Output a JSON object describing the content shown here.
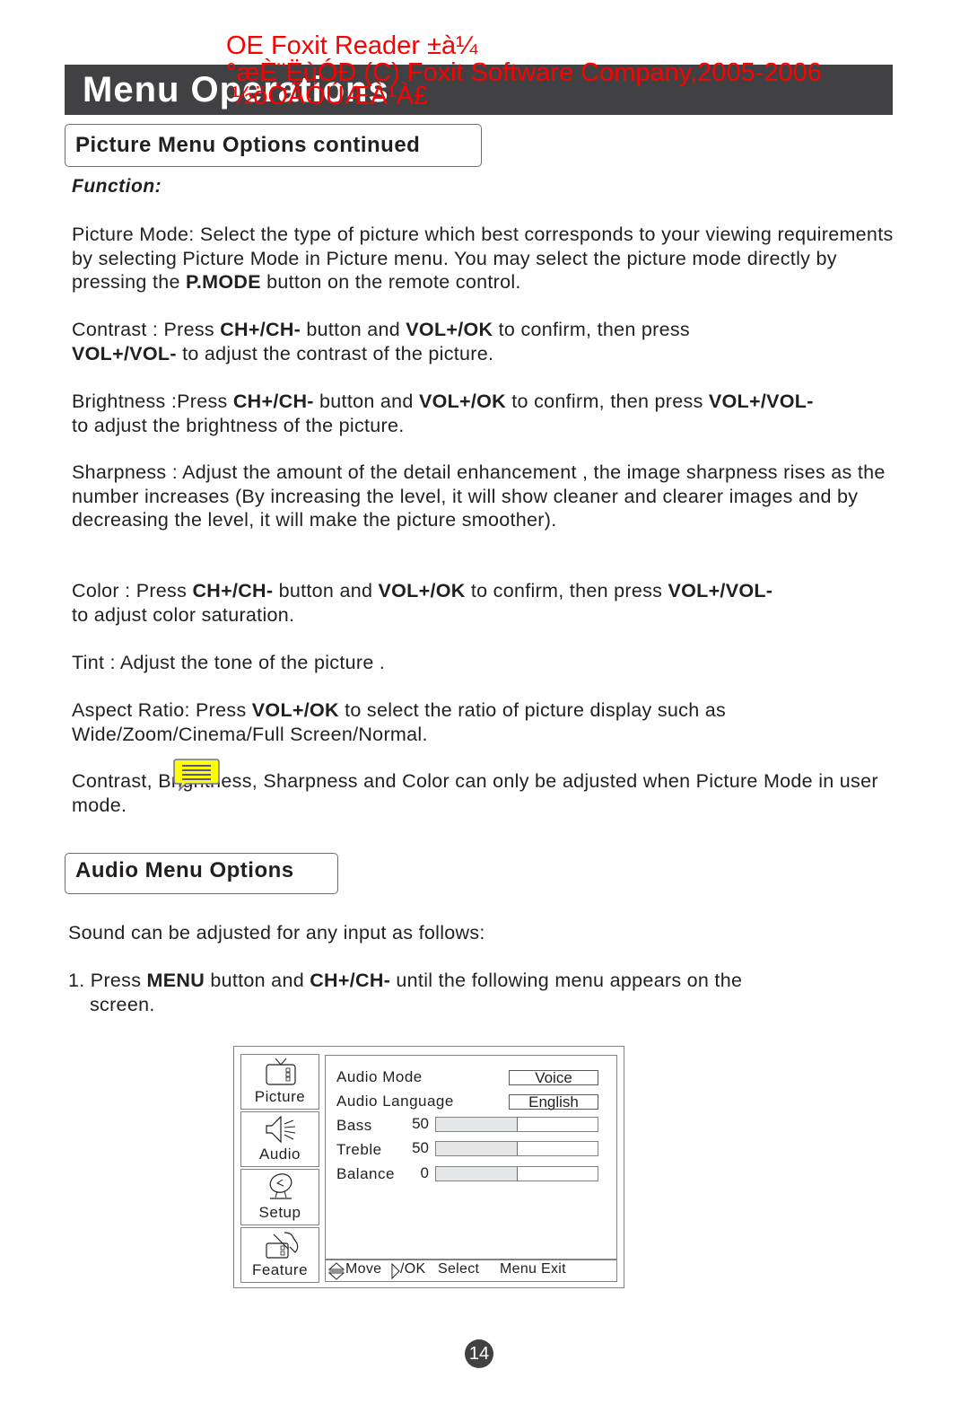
{
  "watermark": {
    "line1": "OE Foxit Reader ±à¼­",
    "line2": "°æÈ¨ËùÓÐ (C) Foxit Software Company,2005-2006",
    "line3": "½öÓÃÓÚÆÀ¹À£",
    "color": "#ff0000"
  },
  "header": {
    "title": "Menu Operations"
  },
  "picture_section": {
    "title": "Picture Menu Options continued",
    "function_label": "Function:",
    "paragraphs": {
      "picture_mode": {
        "a": "Picture Mode: Select the type of picture which best corresponds to your viewing requirements by selecting Picture Mode in Picture menu. You may select the picture mode directly by pressing the ",
        "b1": "P.MODE",
        "c": " button on the remote control."
      },
      "contrast": {
        "a": "Contrast : Press ",
        "b1": "CH+/CH-",
        "c": " button and ",
        "b2": "VOL+/OK",
        "d": " to confirm, then press ",
        "b3": "VOL+/VOL-",
        "e": " to adjust the contrast of the picture."
      },
      "brightness": {
        "a": "Brightness :Press ",
        "b1": "CH+/CH-",
        "c": " button and ",
        "b2": "VOL+/OK",
        "d": " to confirm, then press ",
        "b3": "VOL+/VOL-",
        "e": " to adjust the brightness of the picture."
      },
      "sharpness": "Sharpness : Adjust the amount of the detail enhancement , the image sharpness rises as the number increases (By increasing the level, it will show cleaner and clearer images and by decreasing the level, it will make the picture smoother).",
      "color": {
        "a": "Color : Press ",
        "b1": "CH+/CH-",
        "c": " button and ",
        "b2": "VOL+/OK",
        "d": " to confirm, then press ",
        "b3": "VOL+/VOL-",
        "e": " to adjust color saturation."
      },
      "tint": "Tint : Adjust the tone of the picture .",
      "aspect_ratio": {
        "a": "Aspect Ratio: Press ",
        "b1": "VOL+/OK",
        "c": " to select the ratio of picture display such as Wide/Zoom/Cinema/Full Screen/Normal."
      },
      "note": "Contrast, Brightness, Sharpness and Color can only be adjusted when Picture Mode in user mode."
    },
    "note_icon": "comment-note-icon"
  },
  "audio_section": {
    "title": "Audio Menu Options",
    "intro": "Sound can be adjusted for any input as follows:",
    "step1": {
      "a": "1. Press ",
      "b1": "MENU",
      "c": " button and ",
      "b2": "CH+/CH-",
      "d": " until the following menu appears on the",
      "e": "screen."
    }
  },
  "tv_menu": {
    "tabs": [
      {
        "label": "Picture",
        "icon": "tv-icon"
      },
      {
        "label": "Audio",
        "icon": "speaker-icon"
      },
      {
        "label": "Setup",
        "icon": "satellite-dish-icon"
      },
      {
        "label": "Feature",
        "icon": "tools-icon"
      }
    ],
    "options": [
      {
        "label": "Audio Mode",
        "value": "Voice"
      },
      {
        "label": "Audio Language",
        "value": "English"
      },
      {
        "label": "Bass",
        "number": "50",
        "level": 0.5
      },
      {
        "label": "Treble",
        "number": "50",
        "level": 0.5
      },
      {
        "label": "Balance",
        "number": "0",
        "level": 0.5
      }
    ],
    "footer": {
      "move": "Move",
      "ok": "/OK",
      "select": "Select",
      "menu_exit": "Menu Exit"
    }
  },
  "page_number": "14"
}
